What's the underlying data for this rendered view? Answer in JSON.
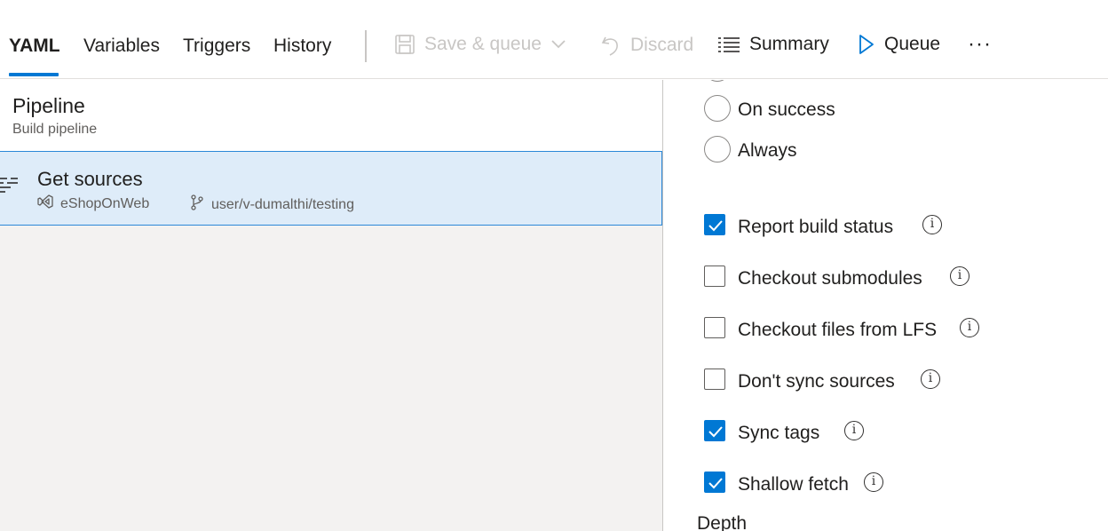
{
  "tabs": [
    {
      "label": "YAML",
      "active": true
    },
    {
      "label": "Variables",
      "active": false
    },
    {
      "label": "Triggers",
      "active": false
    },
    {
      "label": "History",
      "active": false
    }
  ],
  "toolbar": {
    "save_queue": "Save & queue",
    "discard": "Discard",
    "summary": "Summary",
    "queue": "Queue",
    "more": "···"
  },
  "pipeline": {
    "title": "Pipeline",
    "subtitle": "Build pipeline"
  },
  "get_sources": {
    "title": "Get sources",
    "repo": "eShopOnWeb",
    "branch": "user/v-dumalthi/testing"
  },
  "options": {
    "radios": [
      {
        "label": "On success",
        "selected": false
      },
      {
        "label": "Always",
        "selected": false
      }
    ],
    "checkboxes": [
      {
        "label": "Report build status",
        "checked": true
      },
      {
        "label": "Checkout submodules",
        "checked": false
      },
      {
        "label": "Checkout files from LFS",
        "checked": false
      },
      {
        "label": "Don't sync sources",
        "checked": false
      },
      {
        "label": "Sync tags",
        "checked": true
      },
      {
        "label": "Shallow fetch",
        "checked": true
      }
    ],
    "depth_label": "Depth"
  },
  "colors": {
    "accent": "#0078d4",
    "selected_row": "#deecf9",
    "panel_bg": "#f3f2f1"
  }
}
